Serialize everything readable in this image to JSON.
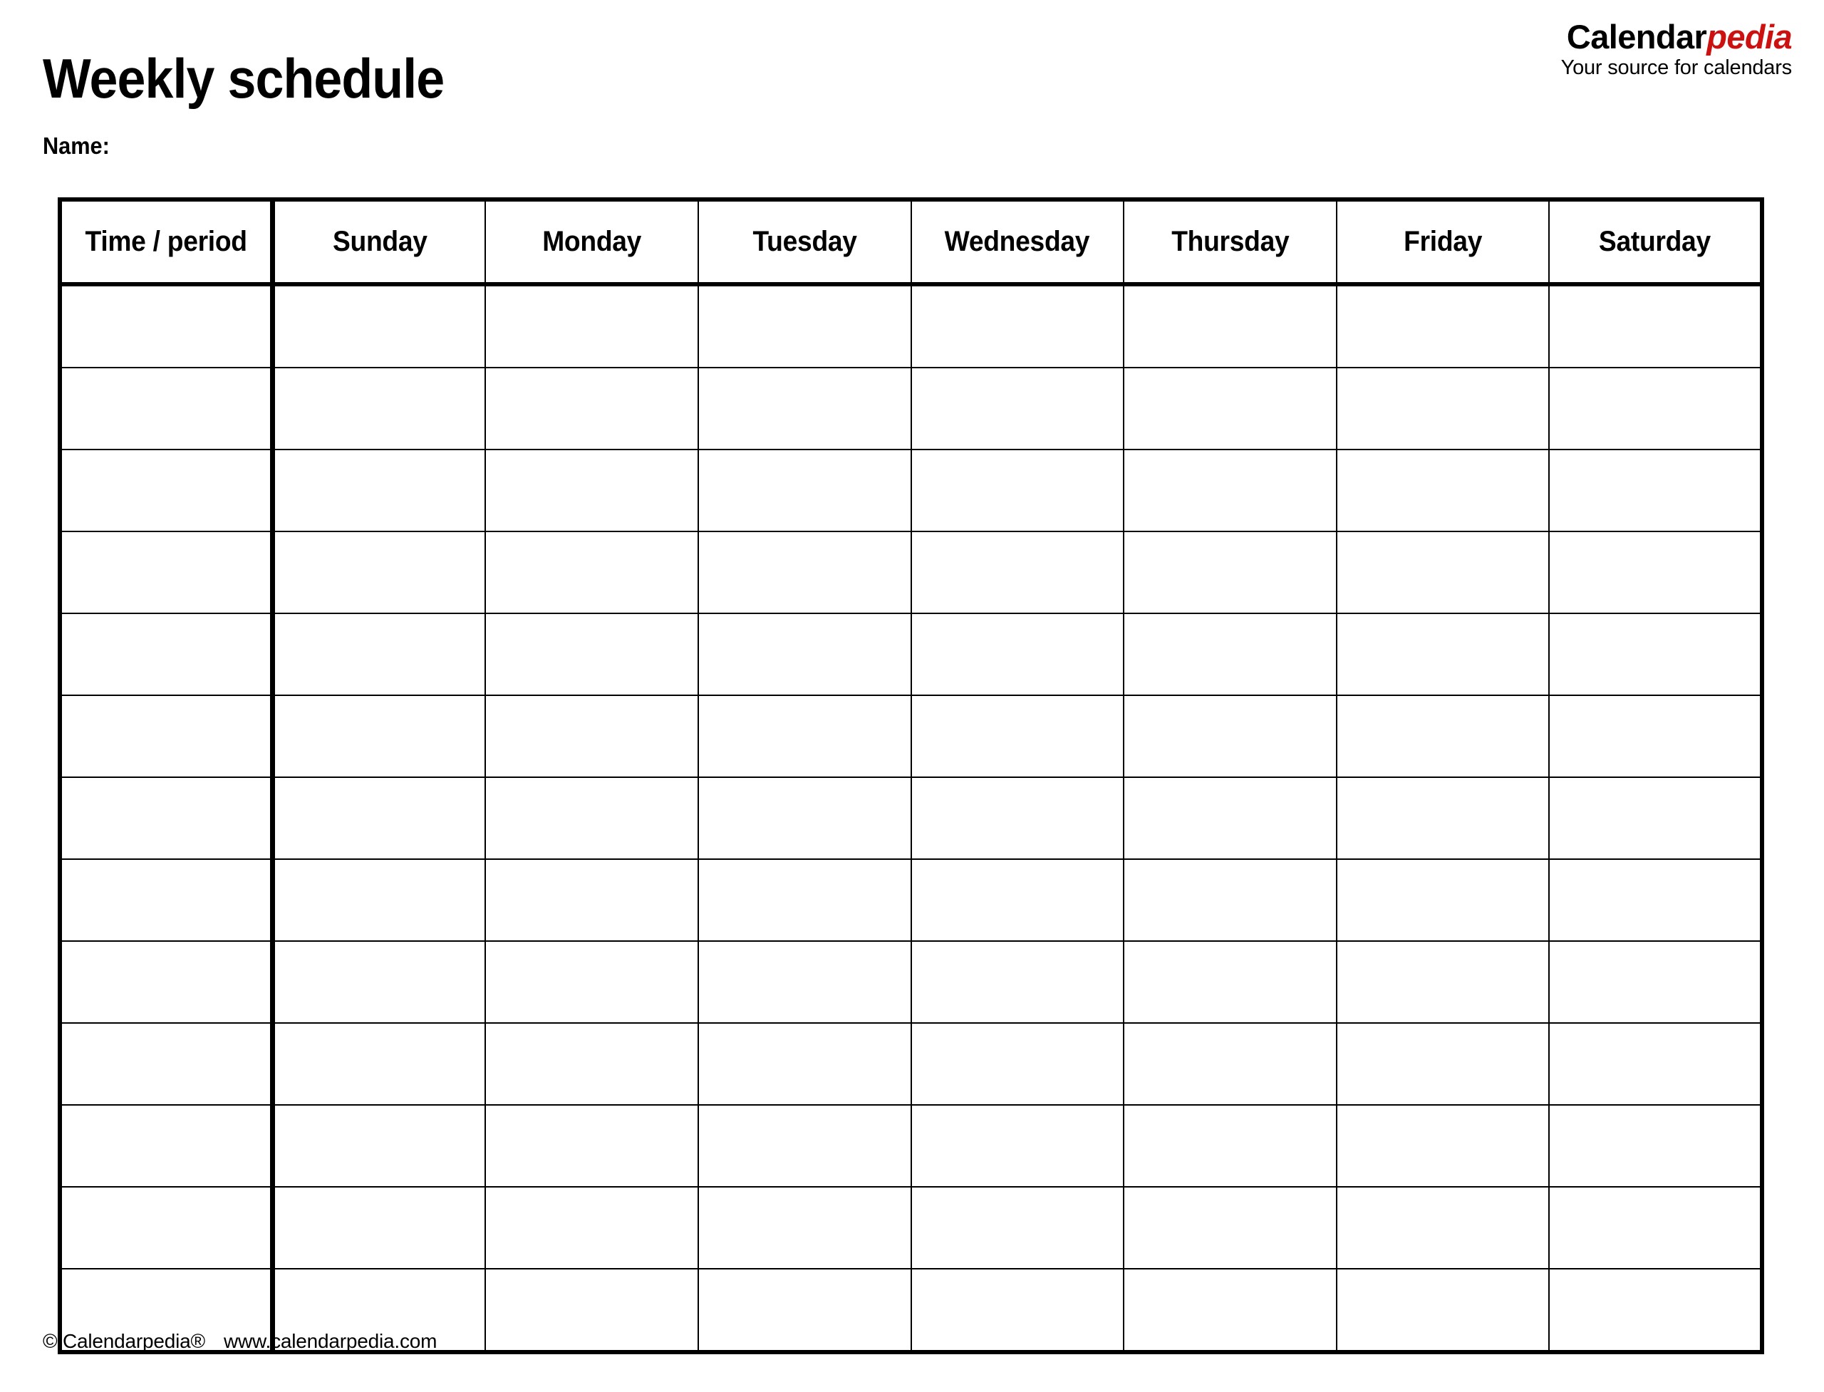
{
  "document": {
    "title": "Weekly schedule",
    "name_label": "Name:"
  },
  "logo": {
    "brand_part1": "Calendar",
    "brand_part2": "pedia",
    "tagline": "Your source for calendars",
    "brand_color_black": "#000000",
    "brand_color_red": "#cc1111"
  },
  "table": {
    "headers": [
      "Time / period",
      "Sunday",
      "Monday",
      "Tuesday",
      "Wednesday",
      "Thursday",
      "Friday",
      "Saturday"
    ],
    "row_count": 13,
    "column_count": 8,
    "rows": [
      [
        "",
        "",
        "",
        "",
        "",
        "",
        "",
        ""
      ],
      [
        "",
        "",
        "",
        "",
        "",
        "",
        "",
        ""
      ],
      [
        "",
        "",
        "",
        "",
        "",
        "",
        "",
        ""
      ],
      [
        "",
        "",
        "",
        "",
        "",
        "",
        "",
        ""
      ],
      [
        "",
        "",
        "",
        "",
        "",
        "",
        "",
        ""
      ],
      [
        "",
        "",
        "",
        "",
        "",
        "",
        "",
        ""
      ],
      [
        "",
        "",
        "",
        "",
        "",
        "",
        "",
        ""
      ],
      [
        "",
        "",
        "",
        "",
        "",
        "",
        "",
        ""
      ],
      [
        "",
        "",
        "",
        "",
        "",
        "",
        "",
        ""
      ],
      [
        "",
        "",
        "",
        "",
        "",
        "",
        "",
        ""
      ],
      [
        "",
        "",
        "",
        "",
        "",
        "",
        "",
        ""
      ],
      [
        "",
        "",
        "",
        "",
        "",
        "",
        "",
        ""
      ],
      [
        "",
        "",
        "",
        "",
        "",
        "",
        "",
        ""
      ]
    ]
  },
  "footer": {
    "copyright": "© Calendarpedia®",
    "website": "www.calendarpedia.com"
  }
}
